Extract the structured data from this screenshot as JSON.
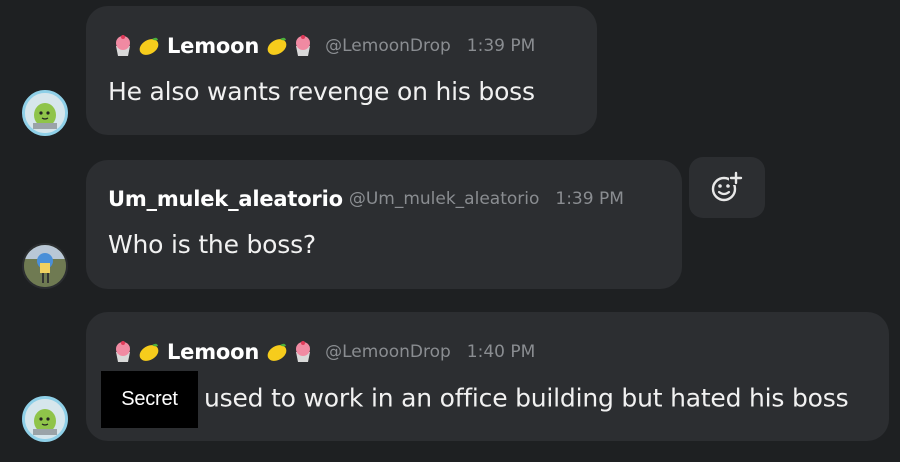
{
  "messages": [
    {
      "author": "Lemoon",
      "handle": "@LemoonDrop",
      "time": "1:39 PM",
      "text": "He also wants revenge on his boss"
    },
    {
      "author": "Um_mulek_aleatorio",
      "handle": "@Um_mulek_aleatorio",
      "time": "1:39 PM",
      "text": "Who is the boss?"
    },
    {
      "author": "Lemoon",
      "handle": "@LemoonDrop",
      "time": "1:40 PM",
      "redacted_label": "Secret",
      "text": "used to work in an office building but hated his boss"
    }
  ],
  "icons": {
    "name_decor_left": [
      "cupcake-icon",
      "lemon-icon"
    ],
    "name_decor_right": [
      "lemon-icon",
      "cupcake-icon"
    ],
    "add_reaction": "add-reaction-icon"
  },
  "colors": {
    "background": "#1e2022",
    "bubble": "#2c2e31",
    "meta_text": "#8a8d91",
    "lemoon_avatar_ring": "#8fd0e8"
  }
}
